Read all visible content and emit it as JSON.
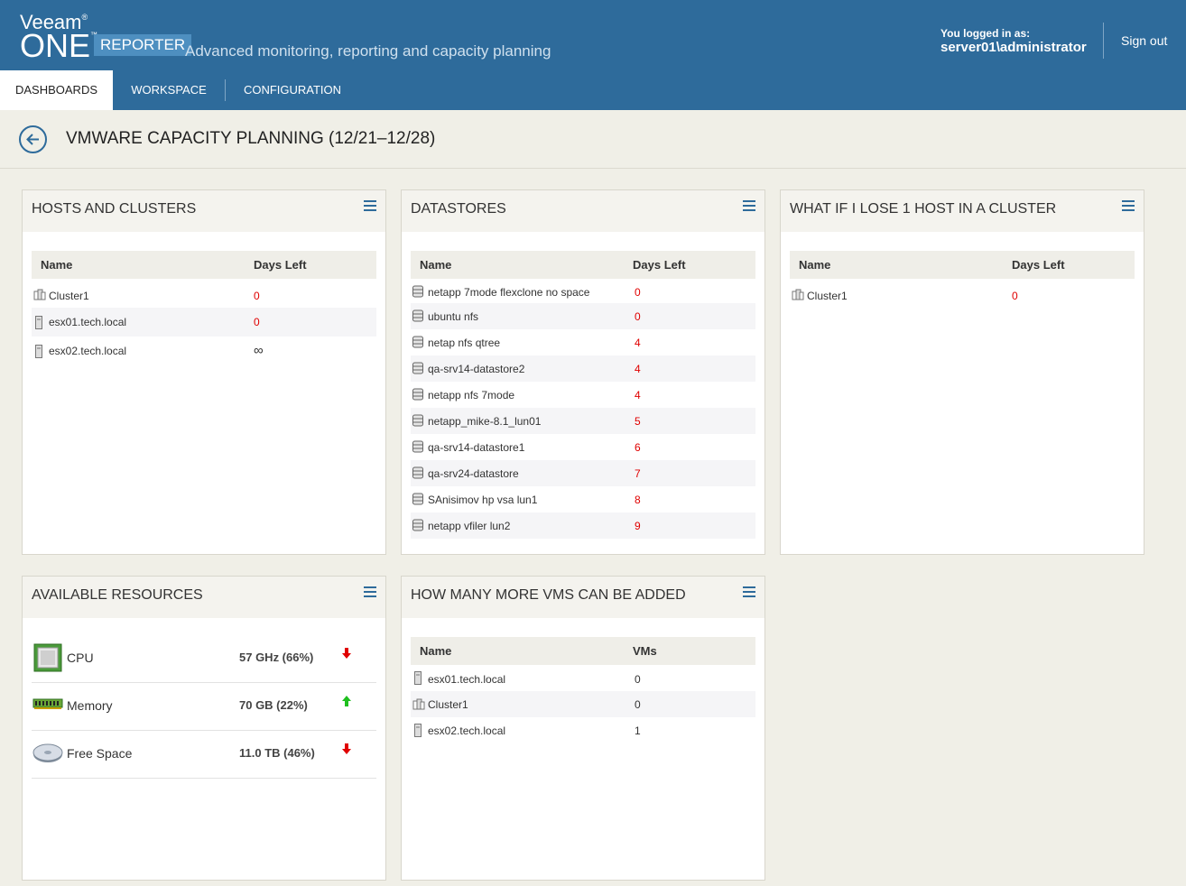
{
  "header": {
    "brand_veeam": "Veeam",
    "brand_one": "ONE",
    "brand_reporter": "REPORTER",
    "tagline": "Advanced monitoring, reporting and capacity planning",
    "login_label": "You logged in as:",
    "login_user": "server01\\administrator",
    "signout": "Sign out"
  },
  "nav": {
    "tabs": [
      {
        "label": "DASHBOARDS",
        "active": true
      },
      {
        "label": "WORKSPACE",
        "active": false
      },
      {
        "label": "CONFIGURATION",
        "active": false
      }
    ]
  },
  "page": {
    "title": "VMWARE CAPACITY PLANNING (12/21–12/28)"
  },
  "hosts_panel": {
    "title": "HOSTS AND CLUSTERS",
    "col_name": "Name",
    "col_days": "Days Left",
    "rows": [
      {
        "icon": "cluster-icon",
        "name": "Cluster1",
        "days": "0"
      },
      {
        "icon": "host-icon",
        "name": "esx01.tech.local",
        "days": "0"
      },
      {
        "icon": "host-icon",
        "name": "esx02.tech.local",
        "days": "∞"
      }
    ]
  },
  "datastores_panel": {
    "title": "DATASTORES",
    "col_name": "Name",
    "col_days": "Days Left",
    "rows": [
      {
        "name": "netapp 7mode flexclone no space",
        "days": "0"
      },
      {
        "name": "ubuntu nfs",
        "days": "0"
      },
      {
        "name": "netap nfs qtree",
        "days": "4"
      },
      {
        "name": "qa-srv14-datastore2",
        "days": "4"
      },
      {
        "name": "netapp nfs 7mode",
        "days": "4"
      },
      {
        "name": "netapp_mike-8.1_lun01",
        "days": "5"
      },
      {
        "name": "qa-srv14-datastore1",
        "days": "6"
      },
      {
        "name": "qa-srv24-datastore",
        "days": "7"
      },
      {
        "name": "SAnisimov hp vsa lun1",
        "days": "8"
      },
      {
        "name": "netapp vfiler lun2",
        "days": "9"
      }
    ]
  },
  "lose_host_panel": {
    "title": "WHAT IF I LOSE 1 HOST IN A CLUSTER",
    "col_name": "Name",
    "col_days": "Days Left",
    "rows": [
      {
        "icon": "cluster-icon",
        "name": "Cluster1",
        "days": "0"
      }
    ]
  },
  "resources_panel": {
    "title": "AVAILABLE RESOURCES",
    "rows": [
      {
        "icon": "cpu-icon",
        "label": "CPU",
        "value": "57 GHz (66%)",
        "trend": "down",
        "trend_color": "#e00000"
      },
      {
        "icon": "memory-icon",
        "label": "Memory",
        "value": "70 GB (22%)",
        "trend": "up",
        "trend_color": "#1fbf1f"
      },
      {
        "icon": "disk-icon",
        "label": "Free Space",
        "value": "11.0 TB (46%)",
        "trend": "down",
        "trend_color": "#e00000"
      }
    ]
  },
  "vms_panel": {
    "title": "HOW MANY MORE VMS CAN BE ADDED",
    "col_name": "Name",
    "col_vms": "VMs",
    "rows": [
      {
        "icon": "host-icon",
        "name": "esx01.tech.local",
        "vms": "0"
      },
      {
        "icon": "cluster-icon",
        "name": "Cluster1",
        "vms": "0"
      },
      {
        "icon": "host-icon",
        "name": "esx02.tech.local",
        "vms": "1"
      }
    ]
  },
  "colors": {
    "header_bg": "#2e6b9b",
    "accent": "#2e6b9b",
    "danger": "#e00000",
    "success": "#1fbf1f"
  }
}
